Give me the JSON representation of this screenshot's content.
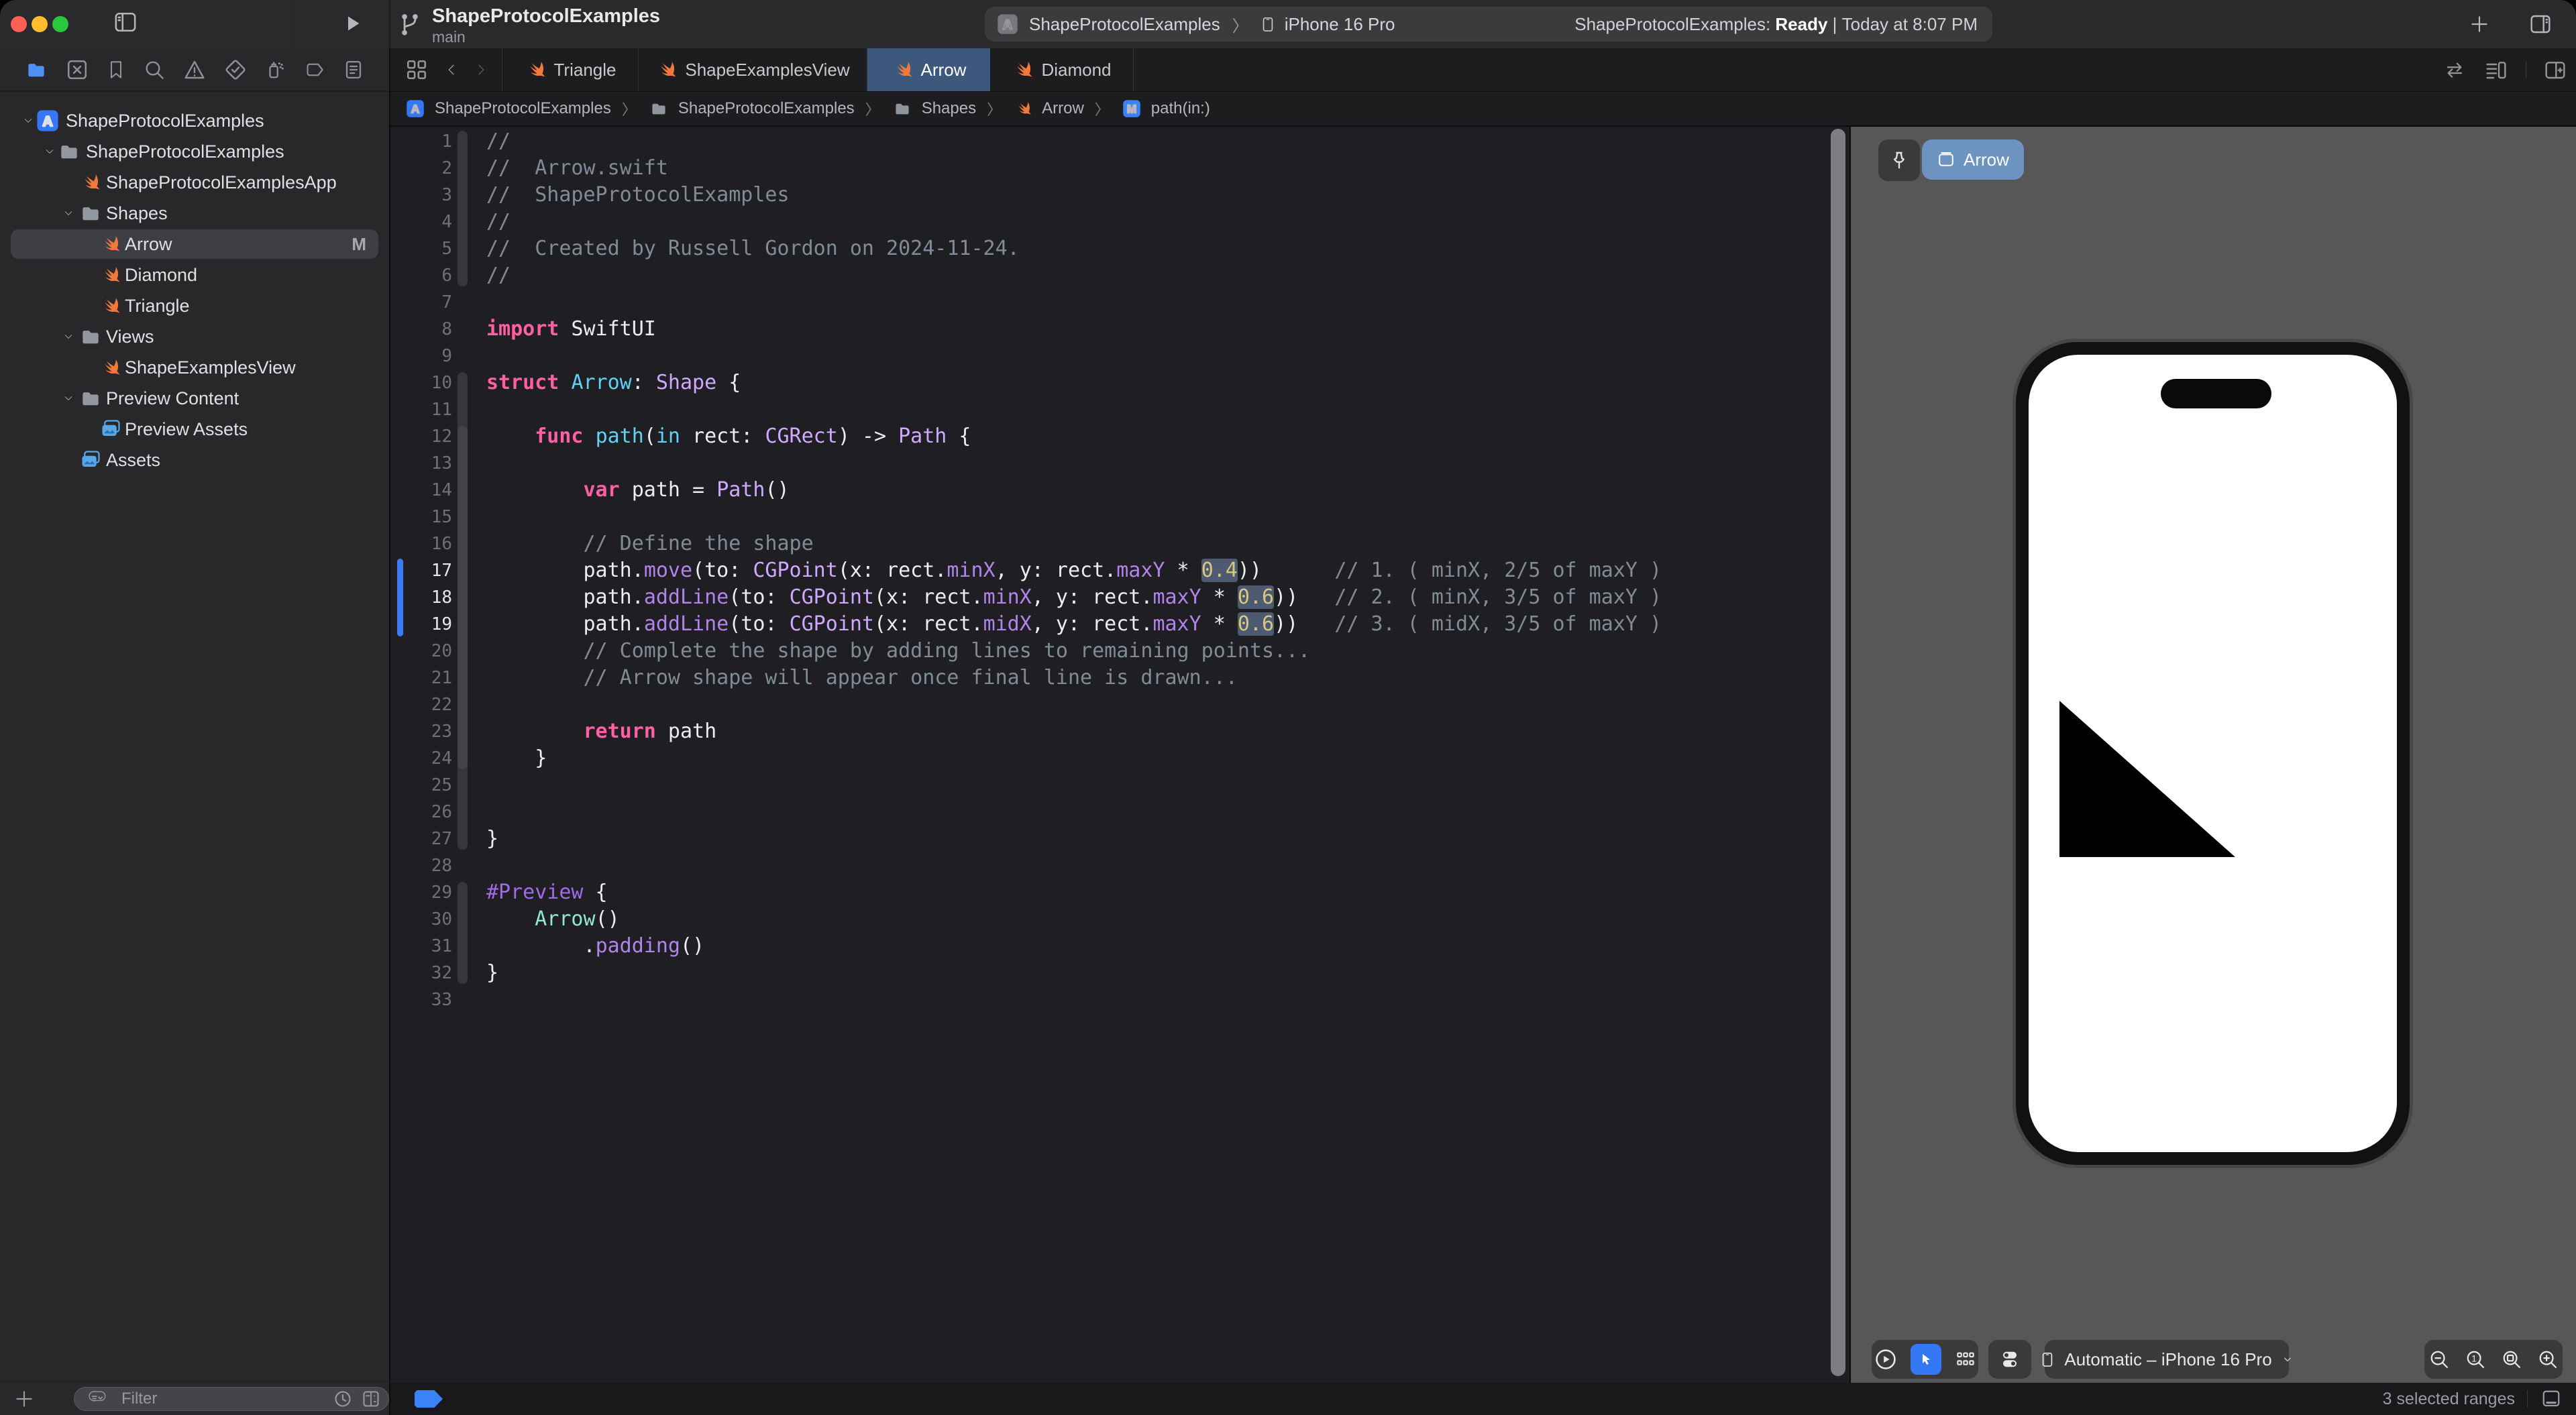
{
  "window": {
    "traffic_lights": [
      "close",
      "minimize",
      "zoom"
    ],
    "project_title": "ShapeProtocolExamples",
    "branch": "main"
  },
  "toolbar": {
    "scheme": {
      "project": "ShapeProtocolExamples",
      "separator": "〉",
      "device": "iPhone 16 Pro"
    },
    "status": {
      "prefix": "ShapeProtocolExamples: ",
      "state": "Ready",
      "separator": " | ",
      "time": "Today at 8:07 PM"
    }
  },
  "navigator": {
    "nav_icons": [
      "folder",
      "box-x",
      "bookmark",
      "search",
      "warning",
      "diamond-check",
      "spray",
      "tag",
      "doc-list"
    ],
    "active_nav_icon": "folder",
    "tree": [
      {
        "label": "ShapeProtocolExamples",
        "icon": "app",
        "chev": 0,
        "indent": 0
      },
      {
        "label": "ShapeProtocolExamples",
        "icon": "folder",
        "chev": 1,
        "indent": 1
      },
      {
        "label": "ShapeProtocolExamplesApp",
        "icon": "swift",
        "indent": 2
      },
      {
        "label": "Shapes",
        "icon": "folder",
        "chev": 2,
        "indent": 2
      },
      {
        "label": "Arrow",
        "icon": "swift",
        "indent": 3,
        "selected": true,
        "badge": "M"
      },
      {
        "label": "Diamond",
        "icon": "swift",
        "indent": 3
      },
      {
        "label": "Triangle",
        "icon": "swift",
        "indent": 3
      },
      {
        "label": "Views",
        "icon": "folder",
        "chev": 2,
        "indent": 2
      },
      {
        "label": "ShapeExamplesView",
        "icon": "swift",
        "indent": 3
      },
      {
        "label": "Preview Content",
        "icon": "folder",
        "chev": 2,
        "indent": 2
      },
      {
        "label": "Preview Assets",
        "icon": "assets",
        "indent": 3
      },
      {
        "label": "Assets",
        "icon": "assets",
        "indent": 2
      }
    ],
    "filter_placeholder": "Filter"
  },
  "tabs": {
    "items": [
      {
        "label": "Triangle",
        "active": false
      },
      {
        "label": "ShapeExamplesView",
        "active": false
      },
      {
        "label": "Arrow",
        "active": true
      },
      {
        "label": "Diamond",
        "active": false
      }
    ]
  },
  "breadcrumb": [
    {
      "icon": "app",
      "label": "ShapeProtocolExamples"
    },
    {
      "icon": "folder",
      "label": "ShapeProtocolExamples"
    },
    {
      "icon": "folder",
      "label": "Shapes"
    },
    {
      "icon": "swift",
      "label": "Arrow"
    },
    {
      "icon": "m",
      "label": "path(in:)"
    }
  ],
  "editor": {
    "selected_lines": [
      17,
      18,
      19
    ],
    "change_bar": [
      17,
      19
    ],
    "ribbons": [
      [
        1,
        6
      ],
      [
        10,
        27
      ],
      [
        29,
        32
      ]
    ],
    "inner_ribbons": [
      [
        12,
        24
      ]
    ],
    "lines": [
      [
        [
          "c",
          "//"
        ]
      ],
      [
        [
          "c",
          "//  Arrow.swift"
        ]
      ],
      [
        [
          "c",
          "//  ShapeProtocolExamples"
        ]
      ],
      [
        [
          "c",
          "//"
        ]
      ],
      [
        [
          "c",
          "//  Created by Russell Gordon on 2024-11-24."
        ]
      ],
      [
        [
          "c",
          "//"
        ]
      ],
      [],
      [
        [
          "k",
          "import"
        ],
        [
          "p",
          " SwiftUI"
        ]
      ],
      [],
      [
        [
          "k",
          "struct"
        ],
        [
          "p",
          " "
        ],
        [
          "d",
          "Arrow"
        ],
        [
          "p",
          ": "
        ],
        [
          "t",
          "Shape"
        ],
        [
          "p",
          " {"
        ]
      ],
      [],
      [
        [
          "p",
          "    "
        ],
        [
          "k",
          "func"
        ],
        [
          "p",
          " "
        ],
        [
          "d",
          "path"
        ],
        [
          "p",
          "("
        ],
        [
          "d",
          "in"
        ],
        [
          "p",
          " rect: "
        ],
        [
          "t",
          "CGRect"
        ],
        [
          "p",
          ") -> "
        ],
        [
          "t",
          "Path"
        ],
        [
          "p",
          " {"
        ]
      ],
      [],
      [
        [
          "p",
          "        "
        ],
        [
          "k",
          "var"
        ],
        [
          "p",
          " path = "
        ],
        [
          "t",
          "Path"
        ],
        [
          "p",
          "()"
        ]
      ],
      [],
      [
        [
          "p",
          "        "
        ],
        [
          "c",
          "// Define the shape"
        ]
      ],
      [
        [
          "p",
          "        path."
        ],
        [
          "m",
          "move"
        ],
        [
          "p",
          "(to: "
        ],
        [
          "t",
          "CGPoint"
        ],
        [
          "p",
          "(x: rect."
        ],
        [
          "m",
          "minX"
        ],
        [
          "p",
          ", y: rect."
        ],
        [
          "m",
          "maxY"
        ],
        [
          "p",
          " * "
        ],
        [
          "sel",
          "0.4"
        ],
        [
          "p",
          "))      "
        ],
        [
          "c",
          "// 1. ( minX, 2/5 of maxY )"
        ]
      ],
      [
        [
          "p",
          "        path."
        ],
        [
          "m",
          "addLine"
        ],
        [
          "p",
          "(to: "
        ],
        [
          "t",
          "CGPoint"
        ],
        [
          "p",
          "(x: rect."
        ],
        [
          "m",
          "minX"
        ],
        [
          "p",
          ", y: rect."
        ],
        [
          "m",
          "maxY"
        ],
        [
          "p",
          " * "
        ],
        [
          "sel",
          "0.6"
        ],
        [
          "p",
          "))   "
        ],
        [
          "c",
          "// 2. ( minX, 3/5 of maxY )"
        ]
      ],
      [
        [
          "p",
          "        path."
        ],
        [
          "m",
          "addLine"
        ],
        [
          "p",
          "(to: "
        ],
        [
          "t",
          "CGPoint"
        ],
        [
          "p",
          "(x: rect."
        ],
        [
          "m",
          "midX"
        ],
        [
          "p",
          ", y: rect."
        ],
        [
          "m",
          "maxY"
        ],
        [
          "p",
          " * "
        ],
        [
          "sel",
          "0.6"
        ],
        [
          "p",
          "))   "
        ],
        [
          "c",
          "// 3. ( midX, 3/5 of maxY )"
        ]
      ],
      [
        [
          "p",
          "        "
        ],
        [
          "c",
          "// Complete the shape by adding lines to remaining points..."
        ]
      ],
      [
        [
          "p",
          "        "
        ],
        [
          "c",
          "// Arrow shape will appear once final line is drawn..."
        ]
      ],
      [],
      [
        [
          "p",
          "        "
        ],
        [
          "k",
          "return"
        ],
        [
          "p",
          " path"
        ]
      ],
      [
        [
          "p",
          "    }"
        ]
      ],
      [],
      [],
      [
        [
          "p",
          "}"
        ]
      ],
      [],
      [
        [
          "mac",
          "#Preview"
        ],
        [
          "p",
          " {"
        ]
      ],
      [
        [
          "p",
          "    "
        ],
        [
          "mint",
          "Arrow"
        ],
        [
          "p",
          "()"
        ]
      ],
      [
        [
          "p",
          "        ."
        ],
        [
          "m",
          "padding"
        ],
        [
          "p",
          "()"
        ]
      ],
      [
        [
          "p",
          "}"
        ]
      ],
      []
    ]
  },
  "preview": {
    "pinned_tab": "Arrow",
    "device_selector": "Automatic – iPhone 16 Pro"
  },
  "statusbar": {
    "selection_info": "3 selected ranges"
  },
  "colors": {
    "accent_blue": "#3478f6",
    "tab_active": "#3c587c",
    "swift_orange": "#f0793b",
    "traffic_red": "#ff5f57",
    "traffic_yellow": "#febc2e",
    "traffic_green": "#28c840",
    "selection_highlight": "#4d5a71"
  }
}
